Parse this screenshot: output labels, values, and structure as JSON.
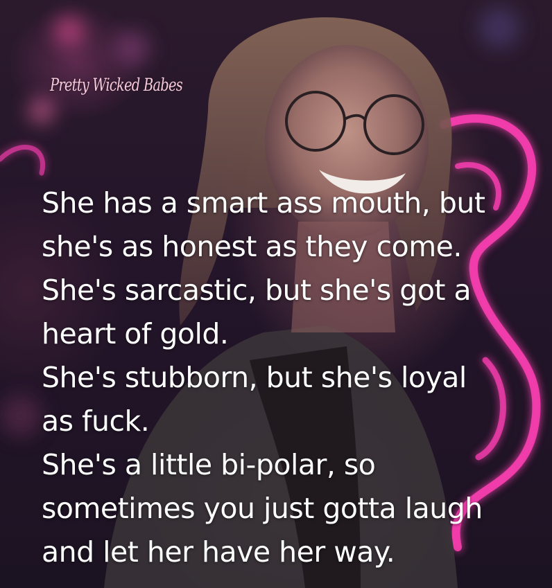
{
  "watermark": "Pretty Wicked Babes",
  "quote_lines": [
    "She has a smart ass mouth, but",
    "she's as honest as they come.",
    "She's sarcastic, but she's got a",
    "heart of gold.",
    "She's stubborn, but she's loyal",
    "as fuck.",
    "She's a little bi-polar, so",
    "sometimes you just gotta laugh",
    "and let her have her way."
  ],
  "colors": {
    "neon": "#ff3fb4",
    "text": "#ffffff",
    "watermark": "#f6c9db"
  }
}
